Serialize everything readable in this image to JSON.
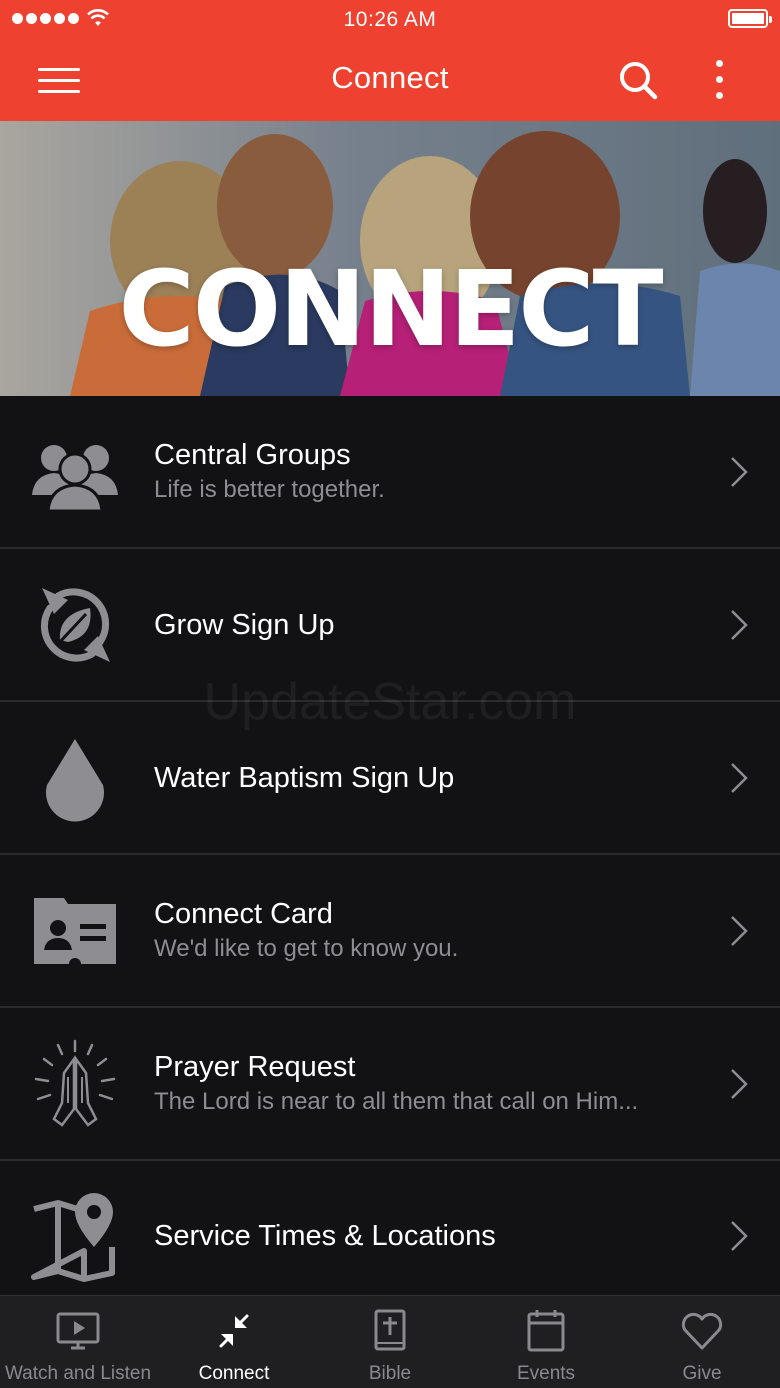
{
  "status_bar": {
    "time": "10:26 AM"
  },
  "header": {
    "title": "Connect",
    "accent_color": "#ee4130"
  },
  "hero": {
    "title": "CONNECT"
  },
  "list": {
    "items": [
      {
        "title": "Central Groups",
        "subtitle": "Life is better together.",
        "icon": "people-group-icon"
      },
      {
        "title": "Grow Sign Up",
        "subtitle": "",
        "icon": "leaf-compass-icon"
      },
      {
        "title": "Water Baptism Sign Up",
        "subtitle": "",
        "icon": "water-drop-icon"
      },
      {
        "title": "Connect Card",
        "subtitle": "We'd like to get to know you.",
        "icon": "contact-card-icon"
      },
      {
        "title": "Prayer Request",
        "subtitle": "The Lord is near to all them that call on Him...",
        "icon": "praying-hands-icon"
      },
      {
        "title": "Service Times & Locations",
        "subtitle": "",
        "icon": "map-pin-icon"
      }
    ]
  },
  "watermark": "UpdateStar.com",
  "tab_bar": {
    "active": "Connect",
    "tabs": [
      {
        "label": "Watch and Listen",
        "icon": "video-screen-icon"
      },
      {
        "label": "Connect",
        "icon": "arrows-collapse-icon"
      },
      {
        "label": "Bible",
        "icon": "bible-icon"
      },
      {
        "label": "Events",
        "icon": "calendar-icon"
      },
      {
        "label": "Give",
        "icon": "heart-icon"
      }
    ]
  }
}
